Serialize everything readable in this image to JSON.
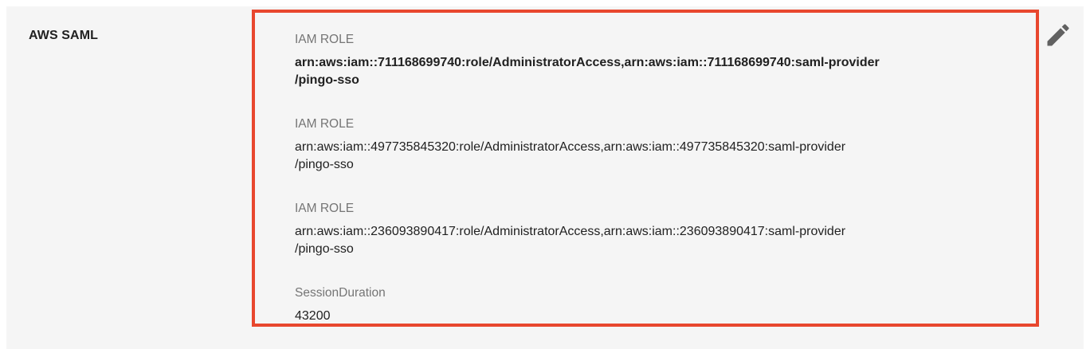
{
  "section": {
    "label": "AWS SAML"
  },
  "attributes": [
    {
      "label": "IAM ROLE",
      "value_line1": "arn:aws:iam::711168699740:role/AdministratorAccess,arn:aws:iam::711168699740:saml-provider",
      "value_line2": "/pingo-sso"
    },
    {
      "label": "IAM ROLE",
      "value_line1": "arn:aws:iam::497735845320:role/AdministratorAccess,arn:aws:iam::497735845320:saml-provider",
      "value_line2": "/pingo-sso"
    },
    {
      "label": "IAM ROLE",
      "value_line1": "arn:aws:iam::236093890417:role/AdministratorAccess,arn:aws:iam::236093890417:saml-provider",
      "value_line2": "/pingo-sso"
    },
    {
      "label": "SessionDuration",
      "value_line1": "43200"
    }
  ],
  "icons": {
    "edit": "pencil-icon"
  },
  "colors": {
    "highlight_border": "#e8472e",
    "panel_background": "#f5f5f5",
    "label_text": "#757575",
    "value_text": "#212121",
    "icon": "#616161"
  }
}
